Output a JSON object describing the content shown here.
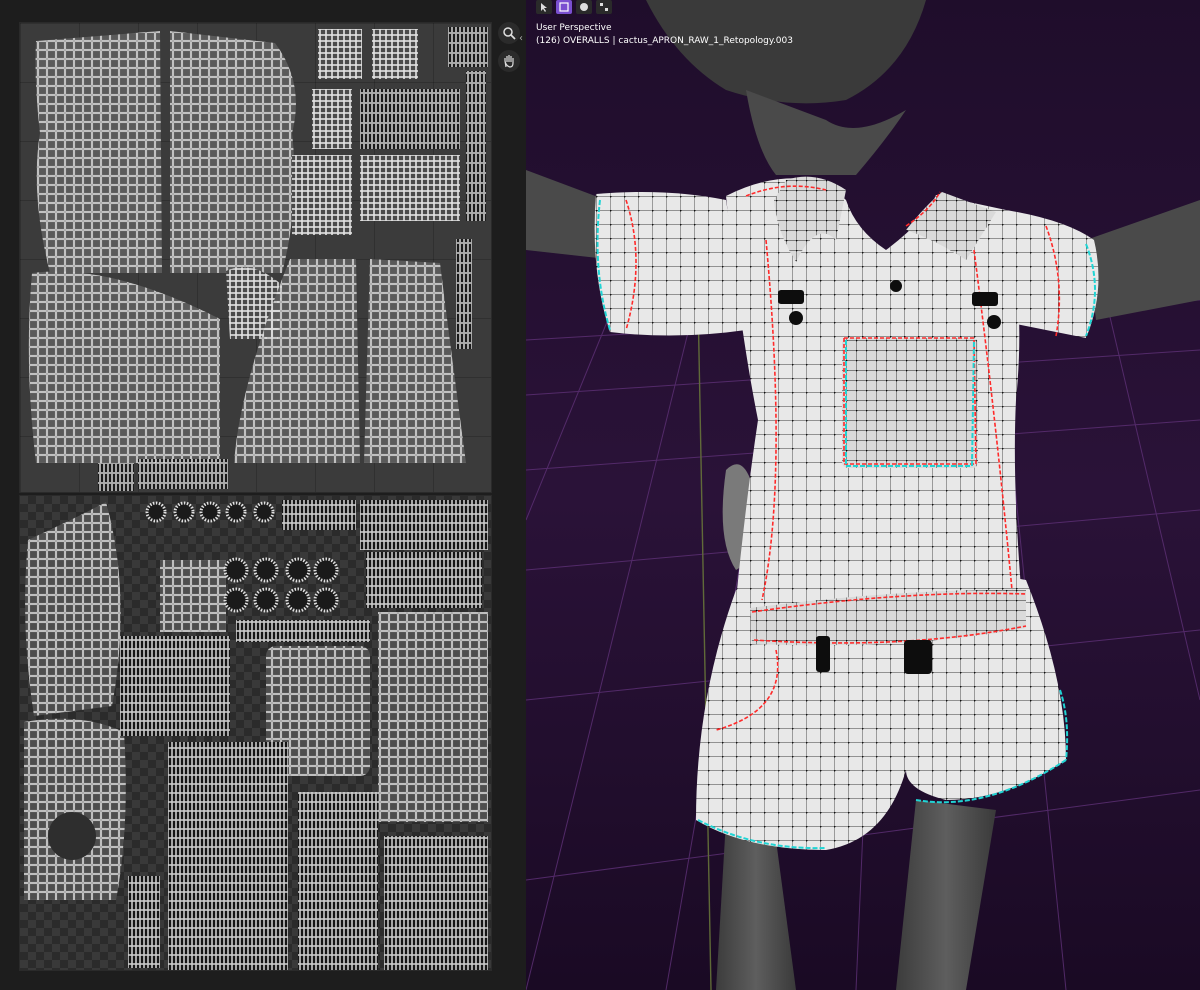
{
  "viewport": {
    "view_name": "User Perspective",
    "object_info": "(126) OVERALLS | cactus_APRON_RAW_1_Retopology.003",
    "seam_color": "#ff2a2a",
    "seam_alt_color": "#20d4d4",
    "background_color": "#1a0c24",
    "grid_color": "#5b2f73"
  },
  "uv_editor": {
    "tools": [
      {
        "icon": "zoom-icon"
      },
      {
        "icon": "hand-pan-icon"
      }
    ]
  },
  "header": {
    "buttons": [
      {
        "icon": "cursor-icon"
      },
      {
        "icon": "overlay-icon"
      },
      {
        "icon": "shading-solid-icon"
      },
      {
        "icon": "shading-wire-icon"
      }
    ]
  }
}
